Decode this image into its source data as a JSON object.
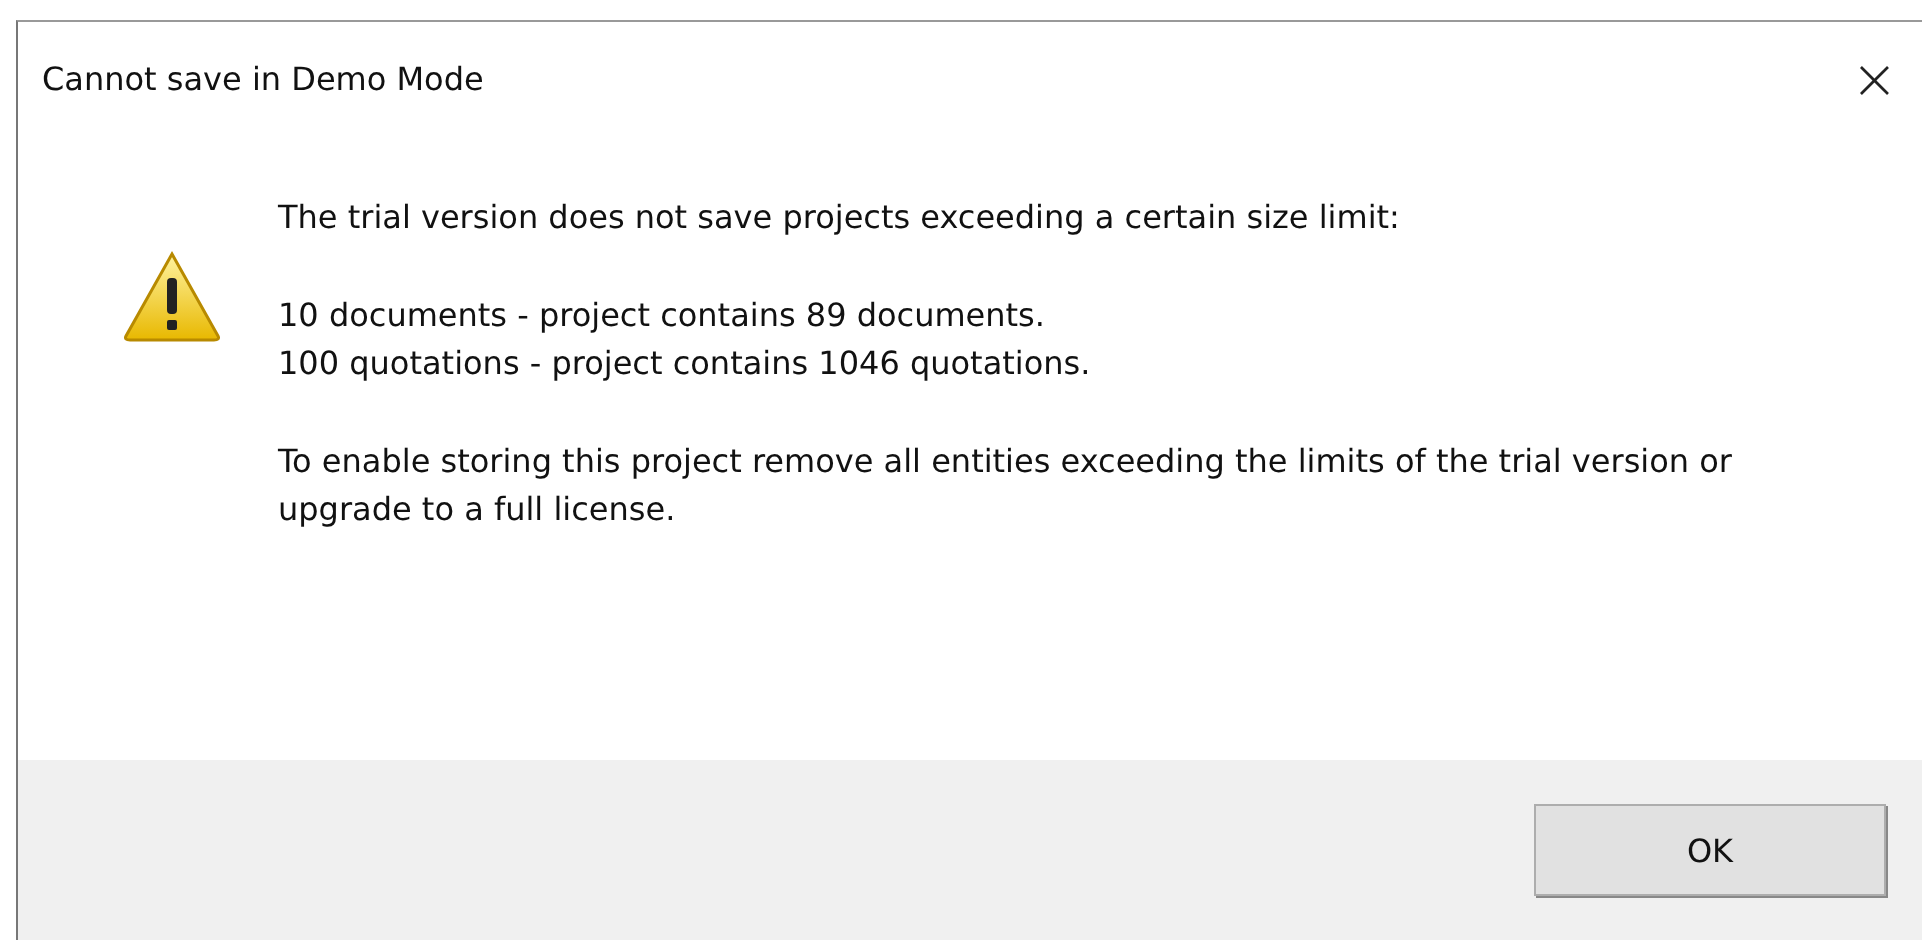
{
  "window": {
    "title": "Cannot save in Demo Mode",
    "close": "×"
  },
  "message": {
    "intro": "The trial version does not save projects exceeding a certain size limit:",
    "limits": [
      "10 documents - project contains 89 documents.",
      "100 quotations - project contains 1046 quotations."
    ],
    "advice": "To enable storing this project remove all entities exceeding the limits of the trial version or upgrade to a full license."
  },
  "buttons": [
    "OK"
  ]
}
